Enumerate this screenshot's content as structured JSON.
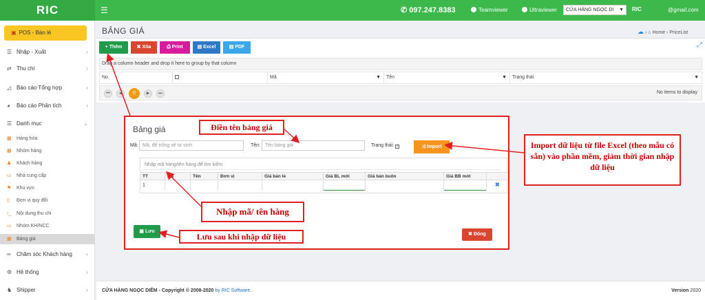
{
  "topbar": {
    "logo": "RIC",
    "menu_icon": "☰",
    "phone": "097.247.8383",
    "teamviewer": "Teamviewer",
    "ultraviewer": "Ultraviewer",
    "store": "CỬA HÀNG NGỌC DI",
    "badge": "RIC",
    "email": "@gmail.com"
  },
  "sidebar": {
    "pos": "POS - Bán lẻ",
    "items": [
      {
        "label": "Nhập - Xuất"
      },
      {
        "label": "Thu chi"
      },
      {
        "label": "Báo cáo Tổng hợp"
      },
      {
        "label": "Báo cáo Phân tích"
      },
      {
        "label": "Danh mục"
      }
    ],
    "sub": [
      {
        "label": "Hàng hóa"
      },
      {
        "label": "Nhóm hàng"
      },
      {
        "label": "Khách hàng"
      },
      {
        "label": "Nhà cung cấp"
      },
      {
        "label": "Khu vực"
      },
      {
        "label": "Đơn vị quy đổi"
      },
      {
        "label": "Nội dung thu chi"
      },
      {
        "label": "Nhóm KH/NCC"
      },
      {
        "label": "Bảng giá"
      }
    ],
    "bottom": [
      {
        "label": "Chăm sóc Khách hàng"
      },
      {
        "label": "Hệ thống"
      },
      {
        "label": "Shipper"
      }
    ]
  },
  "page": {
    "title": "BẢNG GIÁ",
    "breadcrumb_home": "Home",
    "breadcrumb_sep": "›",
    "breadcrumb_current": "PriceList"
  },
  "toolbar": {
    "add": "Thêm",
    "delete": "Xóa",
    "print": "Print",
    "excel": "Excel",
    "pdf": "PDF"
  },
  "grid": {
    "group_hint": "Drag a column header and drop it here to group by that column",
    "columns": [
      "No.",
      "Mã",
      "Tên",
      "Trạng thái"
    ],
    "current_page": "0",
    "empty": "No items to display"
  },
  "dialog": {
    "title": "Bảng giá",
    "code_label": "Mã:",
    "code_placeholder": "Mã, để trống sẽ tự sinh",
    "name_label": "Tên:",
    "name_placeholder": "Tên bảng giá",
    "status_label": "Trạng thái:",
    "import": "Import",
    "search_placeholder": "Nhập mã hàng/tên hàng để tìm kiếm",
    "columns": [
      "TT",
      "Mã",
      "Tên",
      "Đơn vị",
      "Giá bán lẻ",
      "Giá BL mới",
      "Giá bán buôn",
      "Giá BB mới"
    ],
    "row_index": "1",
    "save": "Lưu",
    "close": "Đóng"
  },
  "annotations": {
    "name": "Điền tên bảng giá",
    "import": "Import dữ liệu từ file Excel (theo mẫu có sẵn) vào phần mềm, giảm thời gian nhập dữ liệu",
    "search": "Nhập mã/ tên hàng",
    "save": "Lưu sau khi nhập dữ liệu"
  },
  "footer": {
    "copyright_prefix": "CỬA HÀNG NGỌC DIỄM - Copyright © 2008-2020",
    "copyright_by": "by RIC Software",
    "copyright_suffix": ".",
    "version_label": "Version",
    "version": "2020"
  },
  "colors": {
    "topbar": "#3cb94a",
    "pos": "#f9c623",
    "add": "#1f9b4a",
    "delete": "#d9452f",
    "print": "#d81b9c",
    "excel": "#2e79c7",
    "pdf": "#3aa7e8",
    "import": "#f7941d",
    "annotation": "#e02020"
  }
}
